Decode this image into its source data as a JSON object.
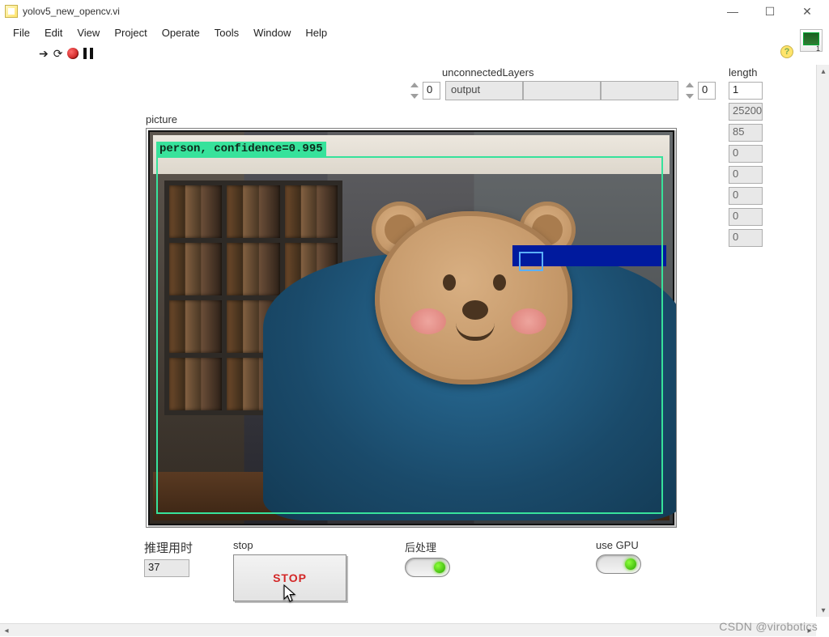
{
  "window": {
    "title": "yolov5_new_opencv.vi",
    "min": "—",
    "max": "☐",
    "close": "✕"
  },
  "menu": {
    "file": "File",
    "edit": "Edit",
    "view": "View",
    "project": "Project",
    "operate": "Operate",
    "tools": "Tools",
    "window": "Window",
    "help": "Help"
  },
  "unconnectedLayers": {
    "label": "unconnectedLayers",
    "index": "0",
    "value": "output",
    "cell2": "",
    "cell3": "",
    "index2": "0"
  },
  "lengthArr": {
    "label": "length",
    "items": [
      "1",
      "25200",
      "85",
      "0",
      "0",
      "0",
      "0",
      "0"
    ]
  },
  "picture": {
    "label": "picture",
    "detection_label": "person, confidence=0.995"
  },
  "inferTime": {
    "label": "推理用时",
    "value": "37"
  },
  "stop": {
    "label": "stop",
    "button": "STOP"
  },
  "postproc": {
    "label": "后处理"
  },
  "useGPU": {
    "label": "use GPU"
  },
  "watermark": "CSDN @virobotics"
}
